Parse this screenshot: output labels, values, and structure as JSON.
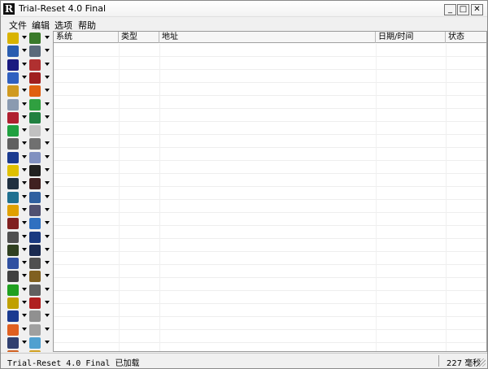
{
  "window": {
    "title": "Trial-Reset 4.0 Final",
    "app_icon_letter": "R",
    "buttons": {
      "minimize": "_",
      "maximize": "□",
      "close": "✕"
    }
  },
  "menu": [
    "文件",
    "编辑",
    "选项",
    "帮助"
  ],
  "columns": [
    "系统",
    "类型",
    "地址",
    "日期/时间",
    "状态"
  ],
  "sidebar": {
    "icons": [
      [
        "#d9b300",
        "#3a7a2a"
      ],
      [
        "#2a5db0",
        "#5a6a7a"
      ],
      [
        "#1a1a80",
        "#b03030"
      ],
      [
        "#3060c0",
        "#a02020"
      ],
      [
        "#d09a20",
        "#e06010"
      ],
      [
        "#8a9ab0",
        "#30a040"
      ],
      [
        "#b02030",
        "#208040"
      ],
      [
        "#20a040",
        "#c0c0c0"
      ],
      [
        "#606060",
        "#707070"
      ],
      [
        "#1a3a90",
        "#8090c0"
      ],
      [
        "#e0c000",
        "#202020"
      ],
      [
        "#203040",
        "#402020"
      ],
      [
        "#207090",
        "#3060a0"
      ],
      [
        "#e0a000",
        "#505070"
      ],
      [
        "#802020",
        "#3070c0"
      ],
      [
        "#505050",
        "#1a3a80"
      ],
      [
        "#304020",
        "#1a2a50"
      ],
      [
        "#3050a0",
        "#505050"
      ],
      [
        "#404040",
        "#806020"
      ],
      [
        "#20a020",
        "#606060"
      ],
      [
        "#c0a000",
        "#b02020"
      ],
      [
        "#1a3a90",
        "#909090"
      ],
      [
        "#e06020",
        "#a0a0a0"
      ],
      [
        "#304070",
        "#50a0d0"
      ],
      [
        "#d06020",
        "#d0a020"
      ]
    ]
  },
  "status": {
    "left": "Trial-Reset 4.0 Final 已加载",
    "right": "227 毫秒"
  }
}
